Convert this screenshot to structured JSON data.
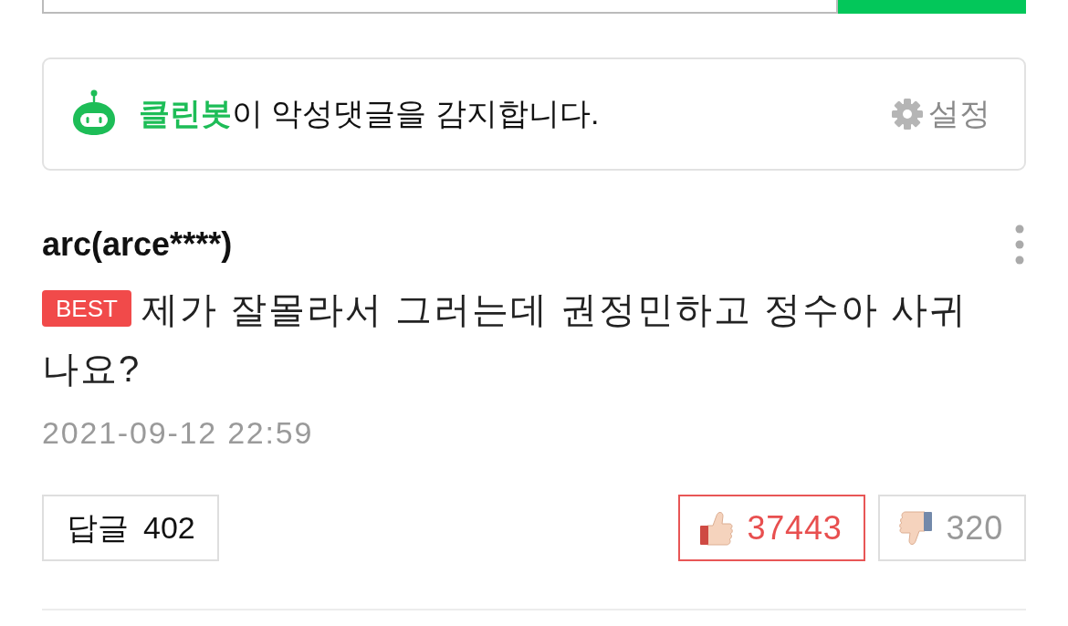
{
  "cleanbot": {
    "message": "**클린봇**이 악성댓글을 감지합니다.",
    "settings_label": "설정"
  },
  "comment": {
    "author": "arc(arce****)",
    "badge": "BEST",
    "text": "제가 잘몰라서 그러는데 권정민하고 정수아 사귀나요?",
    "date": "2021-09-12 22:59",
    "reply_label": "답글",
    "reply_count": "402",
    "reactions": [
      {
        "kind": "like",
        "count": "37443",
        "selected": true
      },
      {
        "kind": "dislike",
        "count": "320",
        "selected": false
      }
    ]
  }
}
